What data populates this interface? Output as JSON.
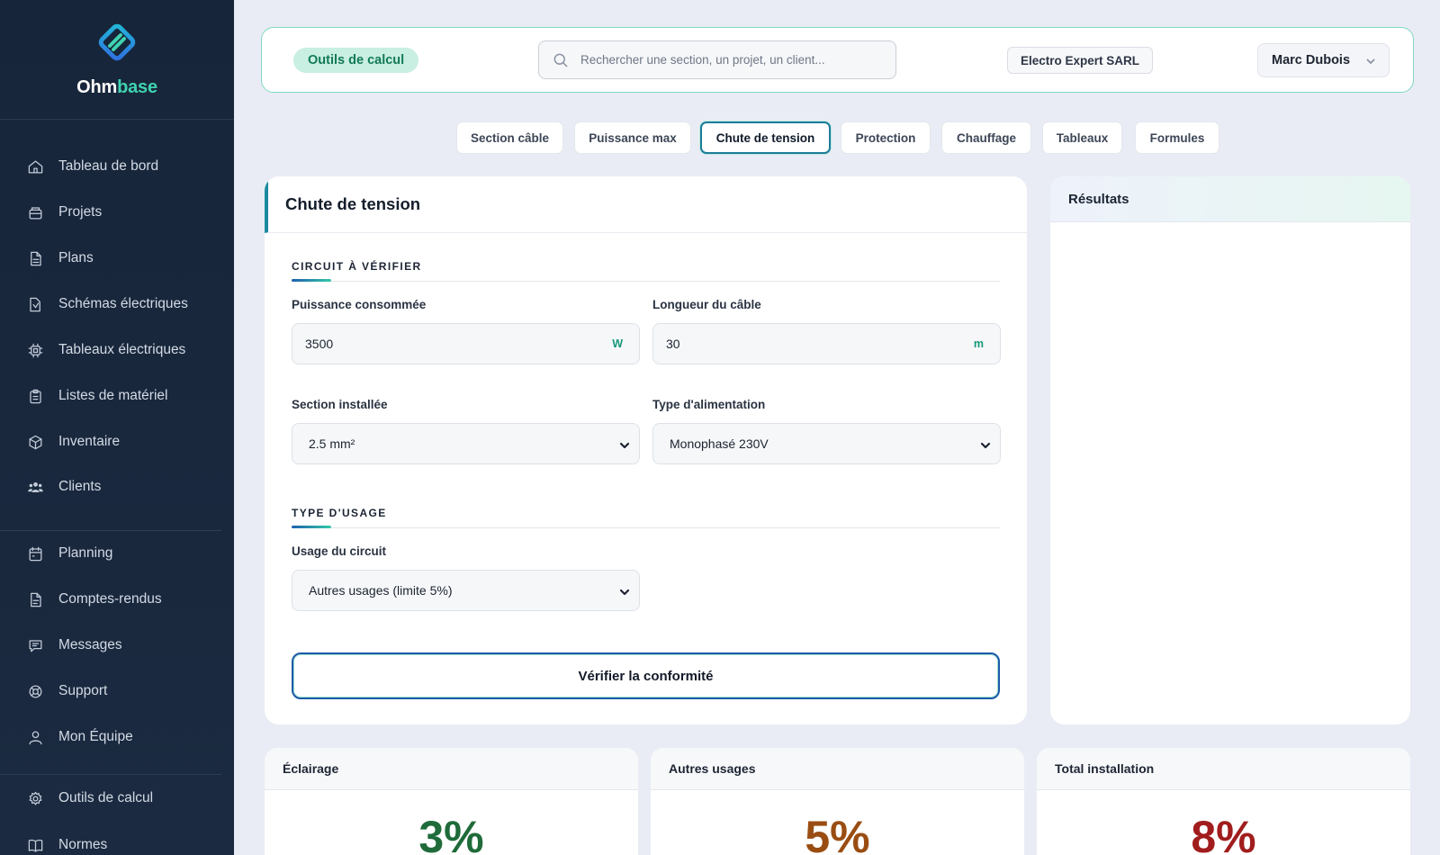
{
  "app": {
    "brand_part1": "Ohm",
    "brand_part2": "base"
  },
  "sidebar": {
    "items": [
      {
        "label": "Tableau de bord",
        "icon": "home-icon"
      },
      {
        "label": "Projets",
        "icon": "folder-icon"
      },
      {
        "label": "Plans",
        "icon": "document-icon"
      },
      {
        "label": "Schémas électriques",
        "icon": "schema-icon"
      },
      {
        "label": "Tableaux électriques",
        "icon": "chip-icon"
      },
      {
        "label": "Listes de matériel",
        "icon": "clipboard-icon"
      },
      {
        "label": "Inventaire",
        "icon": "box-icon"
      },
      {
        "label": "Clients",
        "icon": "users-icon"
      },
      {
        "label": "Planning",
        "icon": "calendar-icon"
      },
      {
        "label": "Comptes-rendus",
        "icon": "report-icon"
      },
      {
        "label": "Messages",
        "icon": "message-icon"
      },
      {
        "label": "Support",
        "icon": "lifebuoy-icon"
      },
      {
        "label": "Mon Équipe",
        "icon": "team-icon"
      },
      {
        "label": "Outils de calcul",
        "icon": "gear-icon"
      },
      {
        "label": "Normes",
        "icon": "book-icon"
      }
    ]
  },
  "topbar": {
    "section_pill": "Outils de calcul",
    "search_placeholder": "Rechercher une section, un projet, un client...",
    "company": "Electro Expert SARL",
    "user_name": "Marc Dubois"
  },
  "tabs": [
    {
      "label": "Section câble"
    },
    {
      "label": "Puissance max"
    },
    {
      "label": "Chute de tension",
      "active": true
    },
    {
      "label": "Protection"
    },
    {
      "label": "Chauffage"
    },
    {
      "label": "Tableaux"
    },
    {
      "label": "Formules"
    }
  ],
  "form": {
    "title": "Chute de tension",
    "section1_title": "CIRCUIT À VÉRIFIER",
    "power_label": "Puissance consommée",
    "power_value": "3500",
    "power_unit": "W",
    "length_label": "Longueur du câble",
    "length_value": "30",
    "length_unit": "m",
    "section_label": "Section installée",
    "section_value": "2.5 mm²",
    "supply_label": "Type d'alimentation",
    "supply_value": "Monophasé 230V",
    "section2_title": "TYPE D'USAGE",
    "usage_label": "Usage du circuit",
    "usage_value": "Autres usages (limite 5%)",
    "verify_button": "Vérifier la conformité"
  },
  "results": {
    "title": "Résultats"
  },
  "limits": [
    {
      "label": "Éclairage",
      "value": "3%",
      "color": "#1f6b3a"
    },
    {
      "label": "Autres usages",
      "value": "5%",
      "color": "#9a4d12"
    },
    {
      "label": "Total installation",
      "value": "8%",
      "color": "#a11d1d"
    }
  ],
  "colors": {
    "accent_teal": "#34c9a8",
    "accent_blue": "#1e5aa8",
    "sidebar_bg": "#17253a"
  }
}
